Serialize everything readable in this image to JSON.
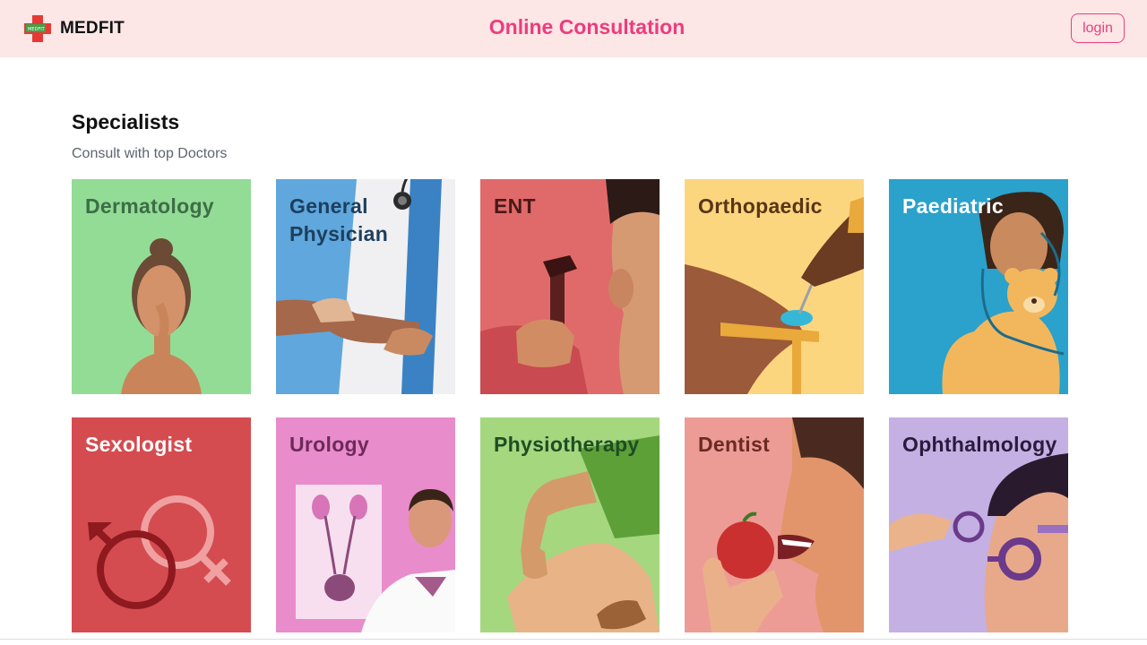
{
  "header": {
    "brand": "MEDFIT",
    "logo_text": "MEDFIT",
    "title": "Online Consultation",
    "login_label": "login",
    "background": "#fce6e6",
    "accent": "#ee3b7d"
  },
  "section": {
    "title": "Specialists",
    "subtitle": "Consult with top Doctors"
  },
  "specialists": [
    {
      "label": "Dermatology",
      "color": "#92dc96",
      "text_color": "#3d6d46",
      "icon": "woman-face-icon"
    },
    {
      "label": "General Physician",
      "color": "#5fa7dd",
      "text_color": "#1d3f5d",
      "icon": "stethoscope-icon"
    },
    {
      "label": "ENT",
      "color": "#e06a6a",
      "text_color": "#4a1818",
      "icon": "otoscope-icon"
    },
    {
      "label": "Orthopaedic",
      "color": "#fbd67f",
      "text_color": "#5a3517",
      "icon": "bone-arm-icon"
    },
    {
      "label": "Paediatric",
      "color": "#2aa2cc",
      "text_color": "#ffffff",
      "icon": "child-teddy-icon"
    },
    {
      "label": "Sexologist",
      "color": "#d44c50",
      "text_color": "#ffffff",
      "icon": "gender-symbols-icon"
    },
    {
      "label": "Urology",
      "color": "#e98ccb",
      "text_color": "#6d2a5b",
      "icon": "kidney-icon"
    },
    {
      "label": "Physiotherapy",
      "color": "#a5d77f",
      "text_color": "#1f4d23",
      "icon": "knee-icon"
    },
    {
      "label": "Dentist",
      "color": "#ec9c94",
      "text_color": "#6b2a24",
      "icon": "apple-mouth-icon"
    },
    {
      "label": "Ophthalmology",
      "color": "#c4b0e3",
      "text_color": "#2a1b3d",
      "icon": "eyeglasses-icon"
    }
  ]
}
